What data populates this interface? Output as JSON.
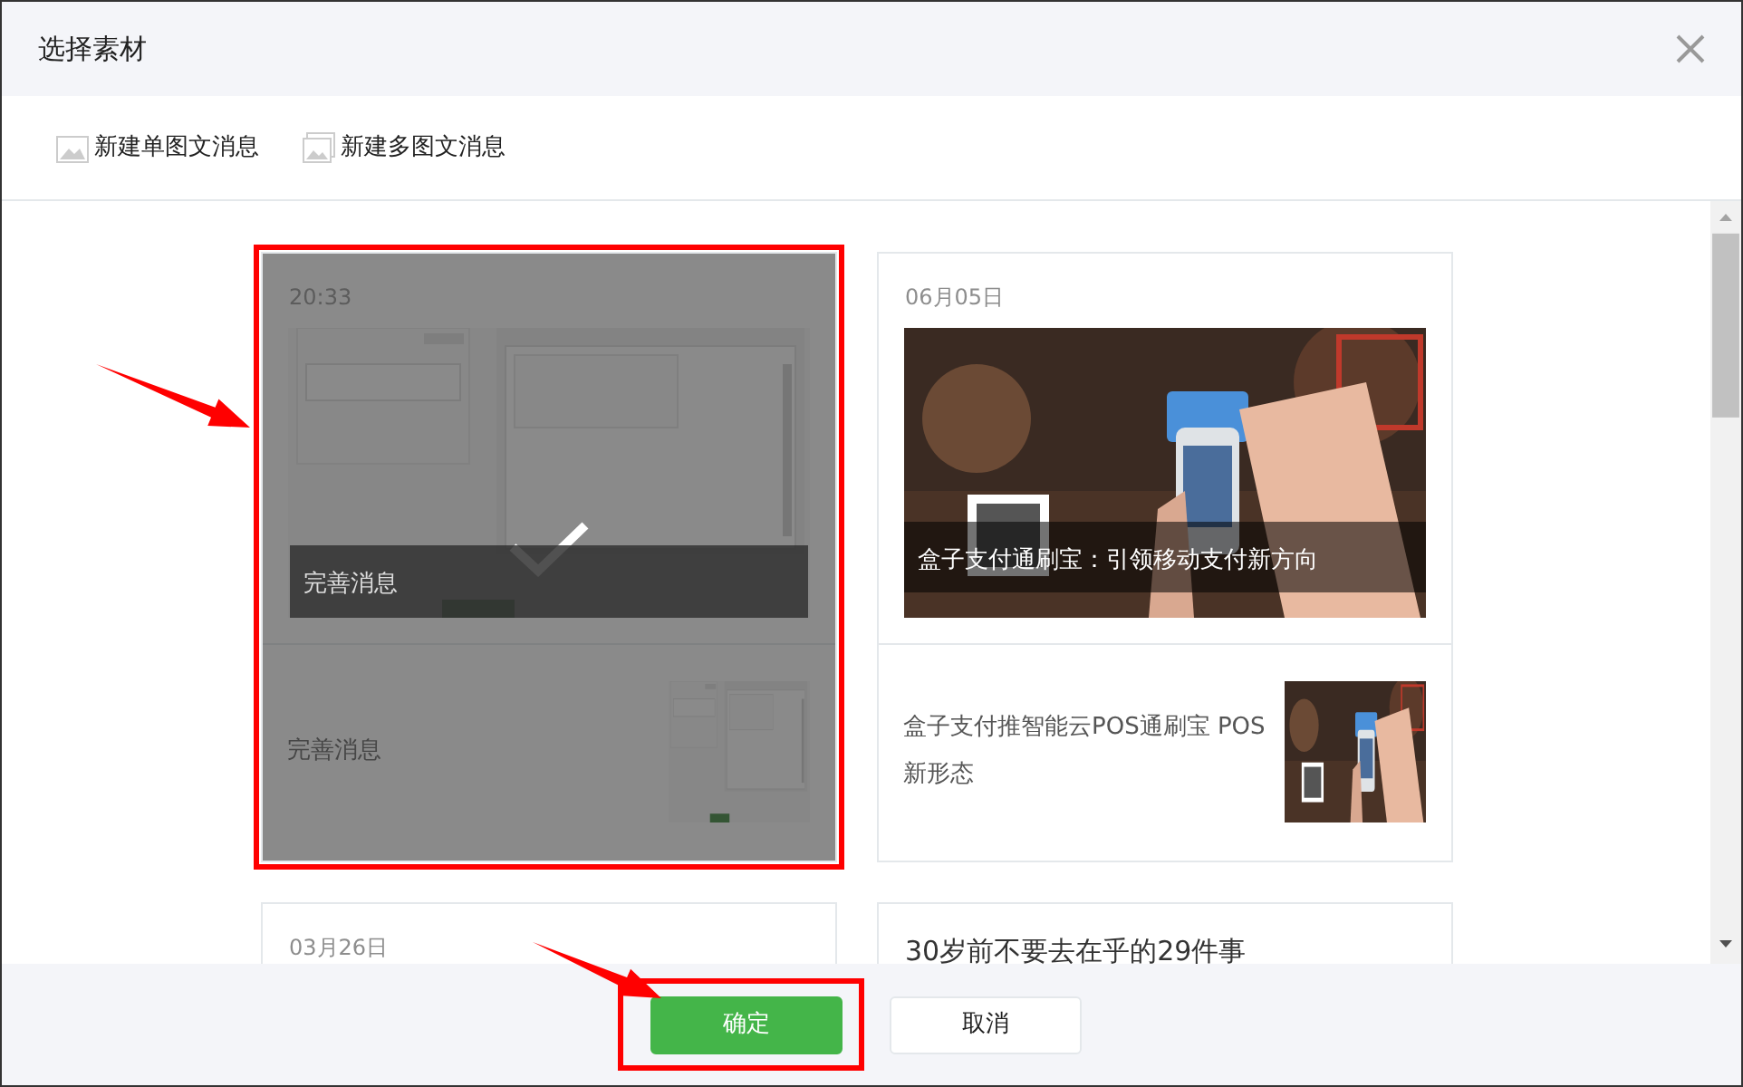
{
  "dialog": {
    "title": "选择素材"
  },
  "toolbar": [
    {
      "label": "新建单图文消息",
      "kind": "single"
    },
    {
      "label": "新建多图文消息",
      "kind": "multi"
    }
  ],
  "cards": [
    {
      "selected": true,
      "highlighted": true,
      "date": "20:33",
      "cover": {
        "kind": "picture",
        "title": "完善消息"
      },
      "items": [
        {
          "title": "完善消息"
        }
      ]
    },
    {
      "selected": false,
      "highlighted": false,
      "date": "06月05日",
      "cover": {
        "kind": "picture",
        "title": "盒子支付通刷宝：引领移动支付新方向"
      },
      "items": [
        {
          "title": "盒子支付推智能云POS通刷宝 POS新形态"
        }
      ]
    },
    {
      "selected": false,
      "highlighted": false,
      "date": "03月26日"
    },
    {
      "selected": false,
      "highlighted": false,
      "title": "30岁前不要去在乎的29件事"
    }
  ],
  "buttons": [
    {
      "label": "确定",
      "kind": "primary",
      "highlighted": true
    },
    {
      "label": "取消",
      "kind": "default",
      "highlighted": false
    }
  ]
}
